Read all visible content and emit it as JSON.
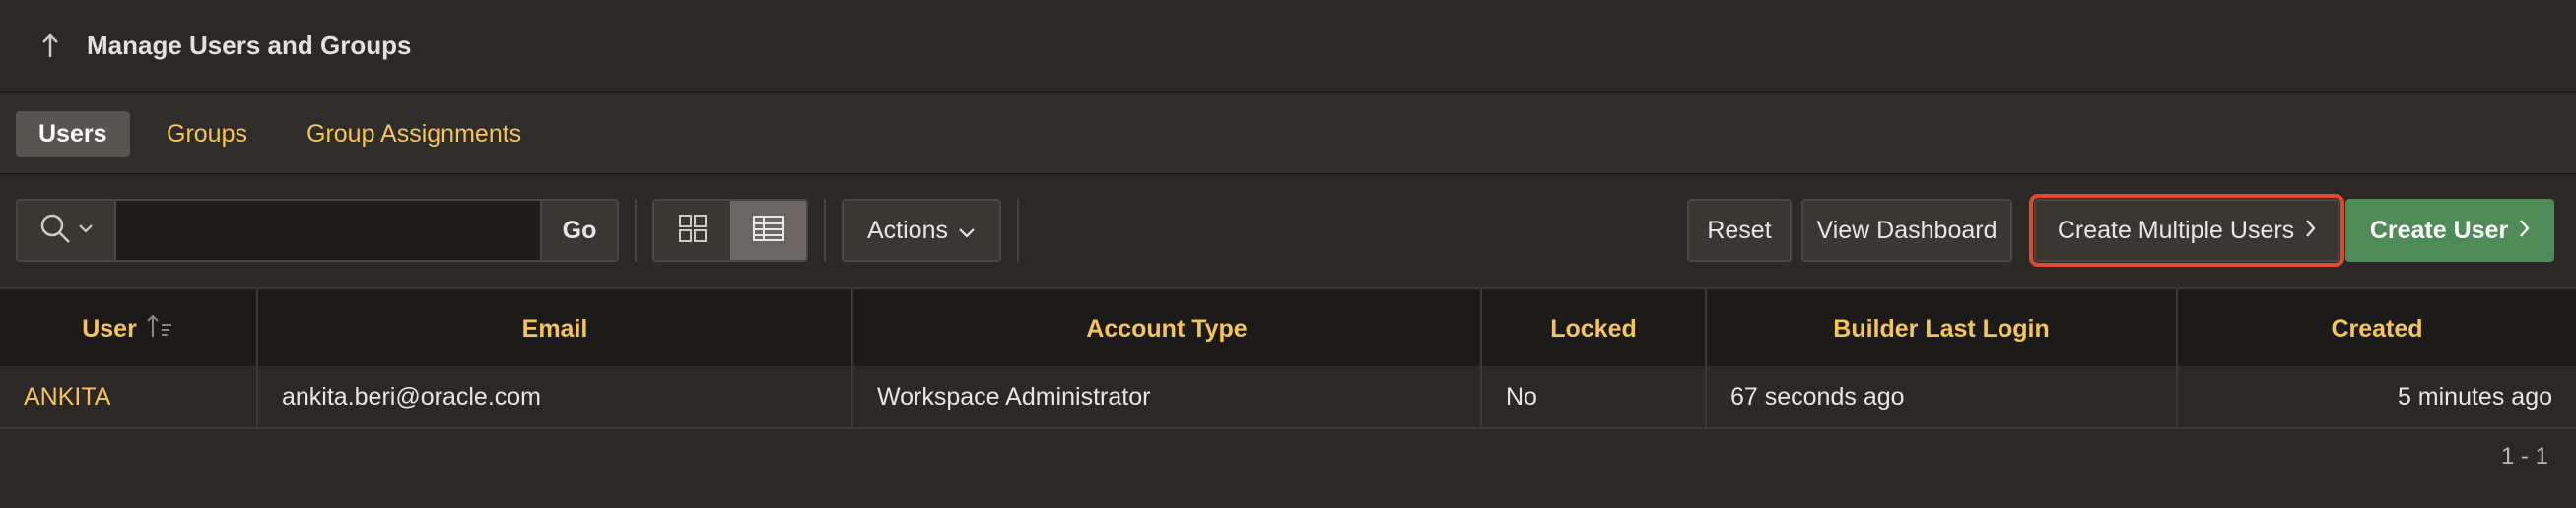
{
  "header": {
    "up_icon": "arrow-up-icon",
    "title": "Manage Users and Groups"
  },
  "tabs": [
    {
      "label": "Users",
      "active": true
    },
    {
      "label": "Groups",
      "active": false
    },
    {
      "label": "Group Assignments",
      "active": false
    }
  ],
  "toolbar": {
    "search_icon": "search-icon",
    "search_value": "",
    "go_label": "Go",
    "view_icons": [
      "grid-view-icon",
      "report-view-icon"
    ],
    "actions_label": "Actions",
    "reset_label": "Reset",
    "view_dashboard_label": "View Dashboard",
    "create_multiple_label": "Create Multiple Users",
    "create_user_label": "Create User"
  },
  "table": {
    "columns": [
      "User",
      "Email",
      "Account Type",
      "Locked",
      "Builder Last Login",
      "Created"
    ],
    "sort_icon": "sort-ascending-icon",
    "rows": [
      {
        "user": "ANKITA",
        "email": "ankita.beri@oracle.com",
        "account_type": "Workspace Administrator",
        "locked": "No",
        "last_login": "67 seconds ago",
        "created": "5 minutes ago"
      }
    ],
    "pagination": "1 - 1"
  },
  "colors": {
    "accent_link": "#f5c45c",
    "primary_button": "#4e8b57",
    "highlight_outline": "#e04a2e"
  }
}
